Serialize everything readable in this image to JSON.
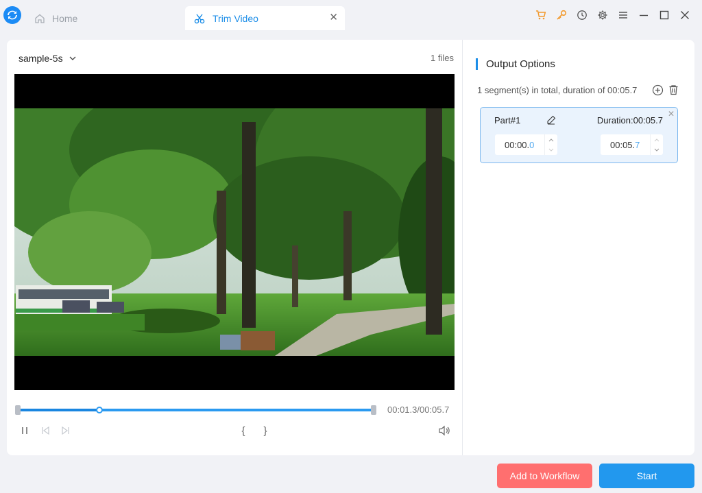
{
  "app": {
    "logo_icon": "app-logo-icon",
    "accent_color": "#1d8ee8"
  },
  "tabs": [
    {
      "label": "Home",
      "icon": "home-icon"
    },
    {
      "label": "Trim Video",
      "icon": "scissors-icon",
      "active": true
    }
  ],
  "window_controls": [
    "cart-icon",
    "key-icon",
    "history-icon",
    "gear-icon",
    "menu-icon",
    "minimize-icon",
    "maximize-icon",
    "close-icon"
  ],
  "file": {
    "name": "sample-5s",
    "count": "1 files"
  },
  "player": {
    "time_readout": "00:01.3/00:05.7",
    "progress_fraction": 0.23,
    "controls": {
      "pause": "pause-icon",
      "prev_frame": "prev-frame-icon",
      "next_frame": "next-frame-icon",
      "mark_in": "{",
      "mark_out": "}",
      "volume": "volume-icon"
    }
  },
  "output": {
    "title": "Output Options",
    "summary": "1 segment(s) in total, duration of 00:05.7",
    "segments": [
      {
        "name": "Part#1",
        "duration": "Duration:00:05.7",
        "start_main": "00:00.",
        "start_frac": "0",
        "end_main": "00:05.",
        "end_frac": "7"
      }
    ]
  },
  "buttons": {
    "add_to_workflow": "Add to Workflow",
    "start": "Start",
    "workflow_color": "#ff6f6f",
    "start_color": "#2298ee"
  }
}
